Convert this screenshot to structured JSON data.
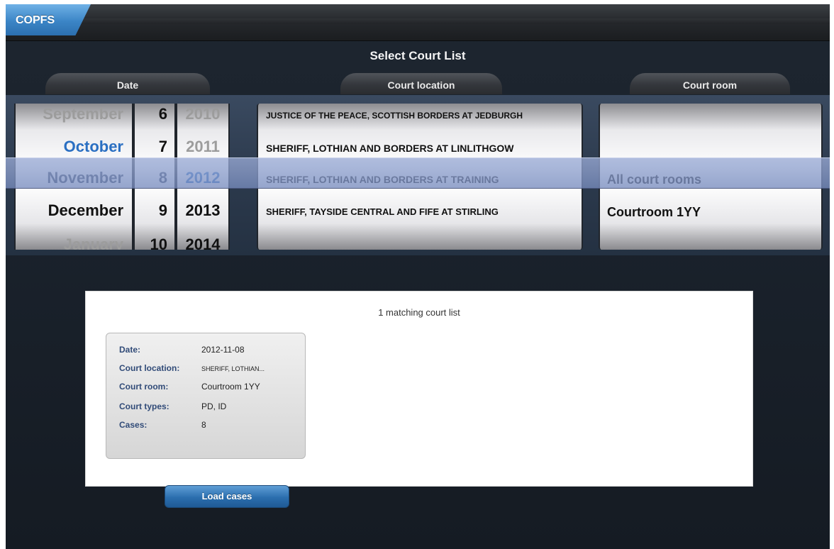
{
  "header": {
    "app_tab": "COPFS"
  },
  "screen_title": "Select Court List",
  "columns": {
    "date": "Date",
    "location": "Court location",
    "room": "Court room"
  },
  "picker": {
    "months": [
      "September",
      "October",
      "November",
      "December",
      "January"
    ],
    "days": [
      "6",
      "7",
      "8",
      "9",
      "10"
    ],
    "years": [
      "2010",
      "2011",
      "2012",
      "2013",
      "2014"
    ],
    "locations": [
      "JUSTICE OF THE PEACE, SCOTTISH BORDERS AT JEDBURGH",
      "SHERIFF, LOTHIAN AND BORDERS AT LINLITHGOW",
      "SHERIFF, LOTHIAN AND BORDERS AT TRAINING",
      "SHERIFF, TAYSIDE CENTRAL AND FIFE AT STIRLING"
    ],
    "rooms": [
      "All court rooms",
      "Courtroom 1YY"
    ]
  },
  "results": {
    "count_text": "1 matching court list",
    "card": {
      "date_label": "Date:",
      "date_value": "2012-11-08",
      "location_label": "Court location:",
      "location_value": "SHERIFF, LOTHIAN...",
      "room_label": "Court room:",
      "room_value": "Courtroom 1YY",
      "types_label": "Court types:",
      "types_value": "PD, ID",
      "cases_label": "Cases:",
      "cases_value": "8"
    },
    "load_button": "Load cases"
  },
  "colors": {
    "accent": "#2a6fc2",
    "selection": "#9aaad4"
  }
}
